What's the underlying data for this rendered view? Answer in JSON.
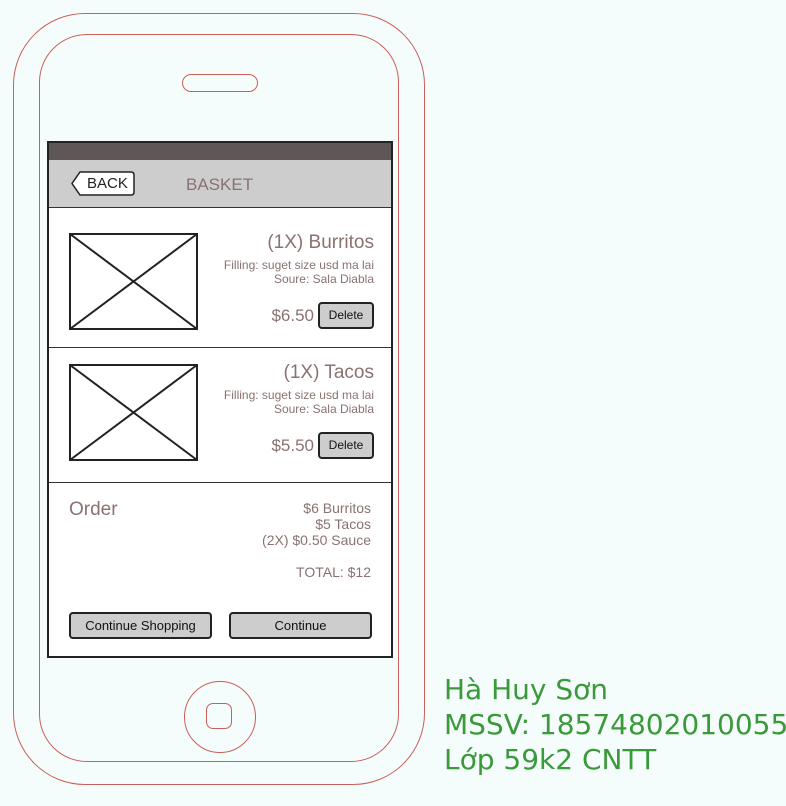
{
  "nav": {
    "back_label": "BACK",
    "title": "BASKET"
  },
  "items": [
    {
      "title": "(1X) Burritos",
      "filling": "Filling: suget size usd ma lai",
      "sauce": "Soure: Sala Diabla",
      "price": "$6.50",
      "delete_label": "Delete"
    },
    {
      "title": "(1X) Tacos",
      "filling": "Filling: suget size usd ma lai",
      "sauce": "Soure: Sala Diabla",
      "price": "$5.50",
      "delete_label": "Delete"
    }
  ],
  "order": {
    "label": "Order",
    "lines": [
      "$6 Burritos",
      "$5 Tacos",
      "(2X) $0.50 Sauce"
    ],
    "total": "TOTAL: $12"
  },
  "actions": {
    "continue_shopping": "Continue Shopping",
    "continue": "Continue"
  },
  "author": {
    "name": "Hà Huy Sơn",
    "mssv": "MSSV: 18574802010055",
    "class": "Lớp 59k2 CNTT"
  },
  "colors": {
    "phone_outline": "#c9605a",
    "text_muted": "#8a7272",
    "nav_bg": "#cdcdcd",
    "status_bar": "#5f5757",
    "author_text": "#3a9a3a"
  },
  "icons": {
    "image_placeholder": "image-placeholder-icon",
    "home": "home-button-icon",
    "back": "back-arrow-icon"
  }
}
